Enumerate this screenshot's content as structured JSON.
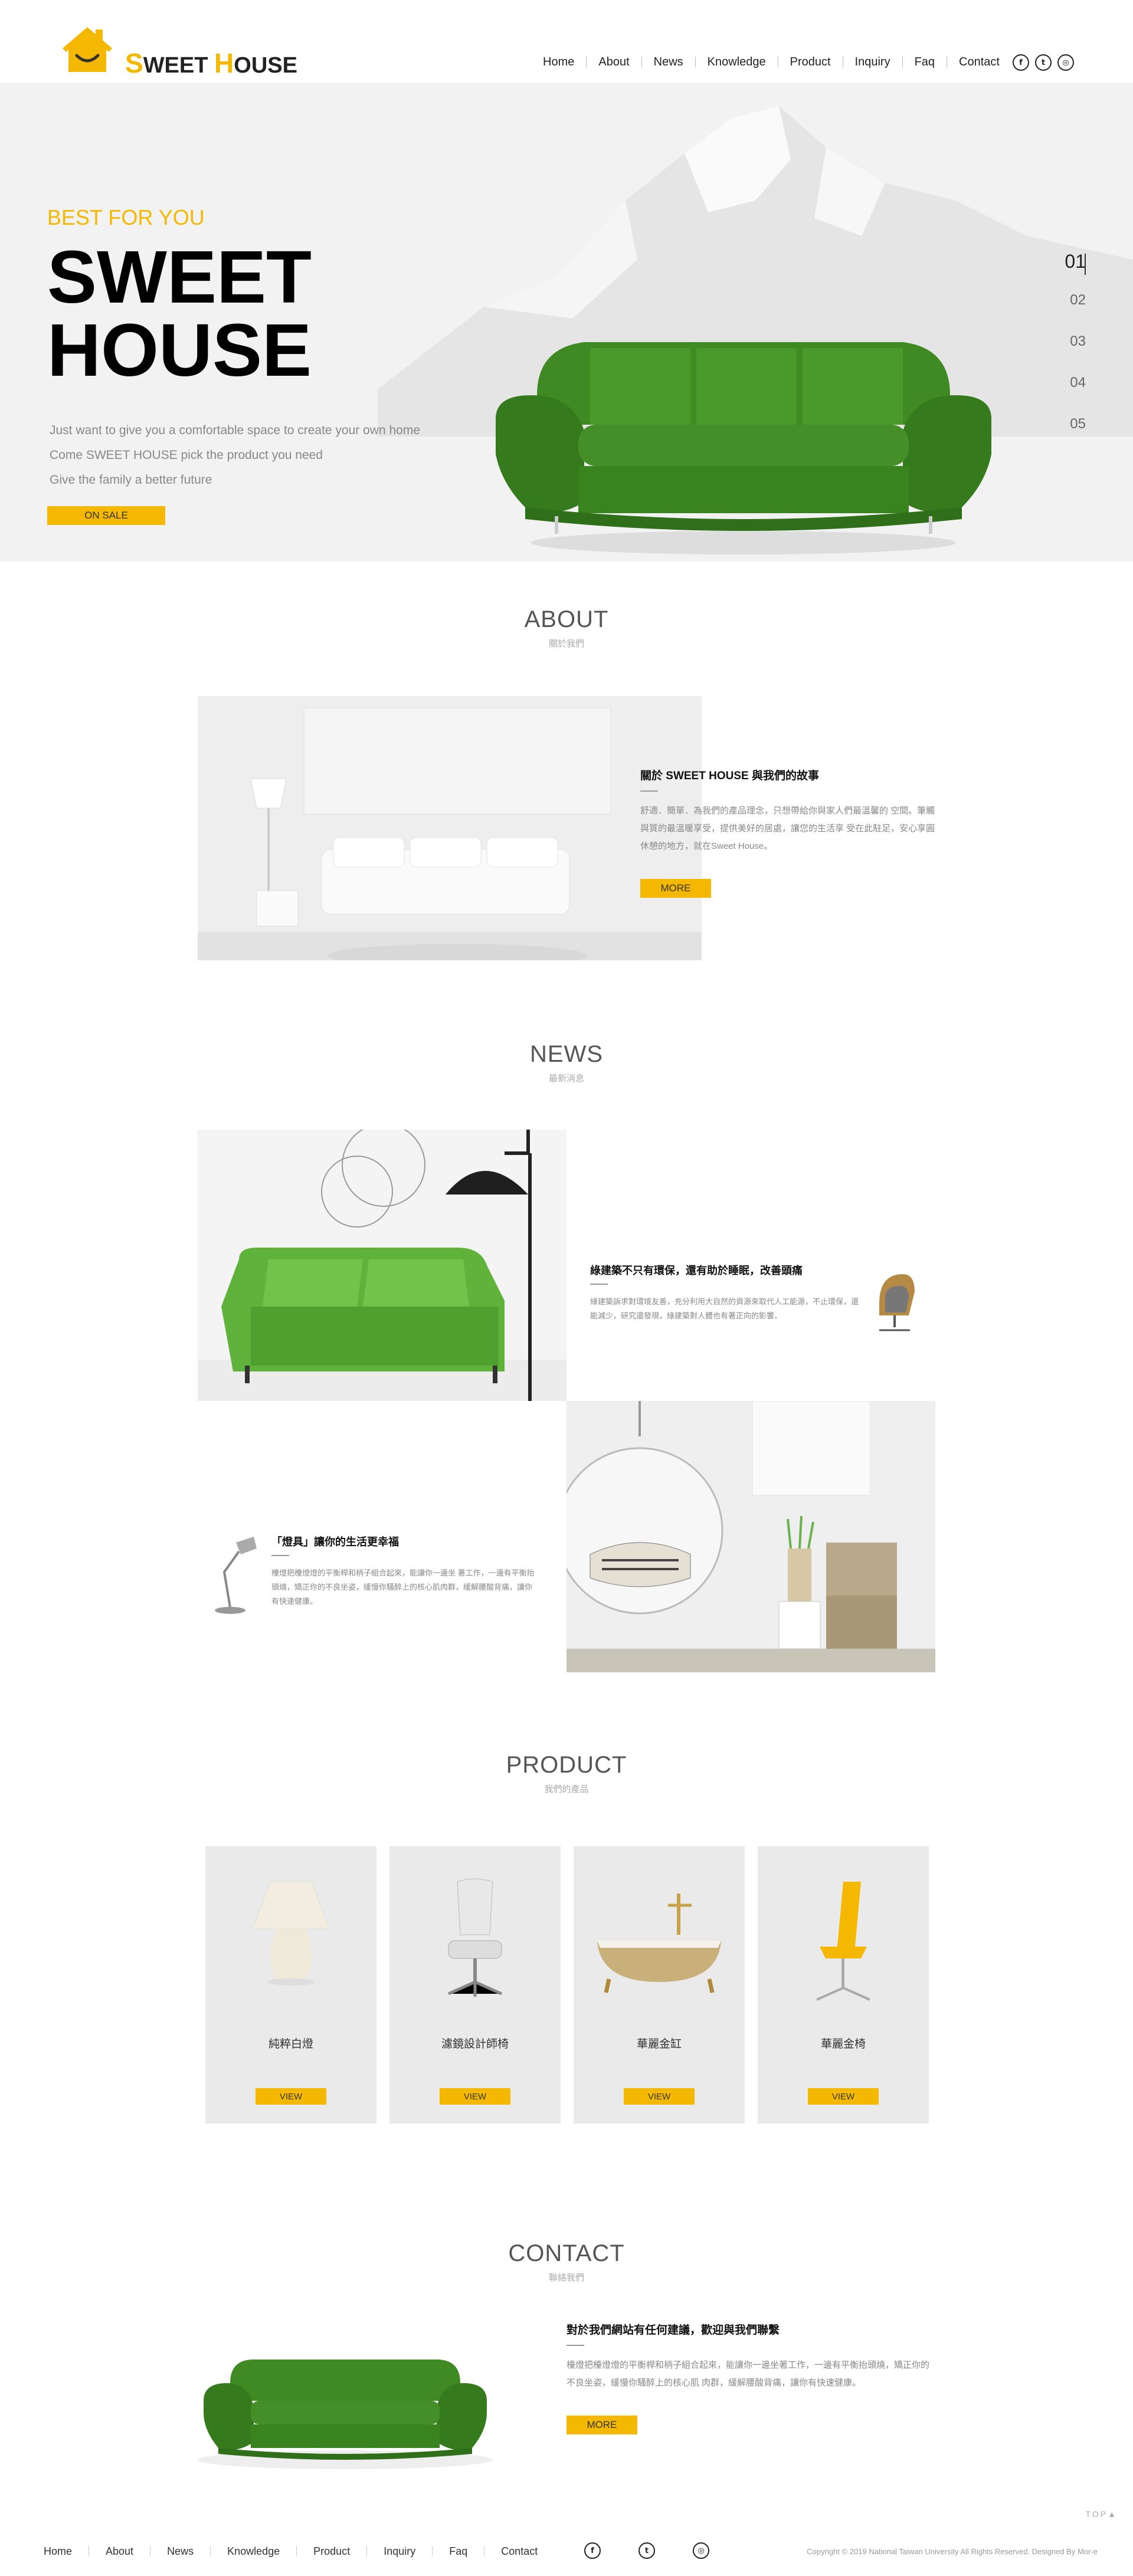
{
  "header": {
    "logo": {
      "initial_1": "S",
      "word_1": "WEET",
      "initial_2": "H",
      "word_2": "OUSE"
    },
    "nav": [
      "Home",
      "About",
      "News",
      "Knowledge",
      "Product",
      "Inquiry",
      "Faq",
      "Contact"
    ],
    "social_icons": [
      "facebook-icon",
      "twitter-icon",
      "instagram-icon"
    ]
  },
  "hero": {
    "tag": "BEST FOR YOU",
    "title_line1": "SWEET",
    "title_line2": "HOUSE",
    "lines": [
      "Just want to give you a comfortable space to create your own home",
      "Come SWEET HOUSE pick the product you need",
      "Give the family a better future"
    ],
    "cta": "ON SALE",
    "pager": [
      "01",
      "02",
      "03",
      "04",
      "05"
    ],
    "active_page": "01"
  },
  "about": {
    "title": "ABOUT",
    "subtitle": "關於我們",
    "heading": "關於 SWEET HOUSE 與我們的故事",
    "body": "舒適．簡單．為我們的產品理念，只想帶給你與家人們最溫馨的 空間。筆觸與質的最溫暖享受，提供美好的居處，讓您的生活享 受在此駐足，安心享圓休憩的地方，就在Sweet House。",
    "button": "MORE"
  },
  "news": {
    "title": "NEWS",
    "subtitle": "最新消息",
    "items": [
      {
        "heading": "綠建築不只有環保，還有助於睡眠，改善頭痛",
        "body": "綠建築訴求對環境友善，充分利用大自然的資源來取代人工能源，不止環保，還能減少，研究還發現，綠建築對人體也有著正向的影響。"
      },
      {
        "heading": "「燈具」讓你的生活更幸福",
        "body": "檯燈把檯燈燈的平衡桿和柄子組合起來，能讓你一邊坐 著工作，一邊有平衡抬頭燒，矯正你的不良坐姿，緩慢你騷醉上的核心肌肉群，緩解腰酸背痛，讓你有快速健康。"
      }
    ]
  },
  "product": {
    "title": "PRODUCT",
    "subtitle": "我們的產品",
    "items": [
      {
        "name": "純粹白燈",
        "button": "VIEW"
      },
      {
        "name": "濾鏡設計師椅",
        "button": "VIEW"
      },
      {
        "name": "華麗金缸",
        "button": "VIEW"
      },
      {
        "name": "華麗金椅",
        "button": "VIEW"
      }
    ]
  },
  "contact": {
    "title": "CONTACT",
    "subtitle": "聯絡我們",
    "heading": "對於我們網站有任何建議，歡迎與我們聯繫",
    "body": "檯燈把檯燈燈的平衡桿和柄子組合起來，能讓你一邊坐著工作，一邊有平衡抬頭燒，矯正你的不良坐姿，緩慢你騷醉上的核心肌 肉群，緩解腰酸背痛，讓你有快速健康。",
    "button": "MORE"
  },
  "footer": {
    "nav": [
      "Home",
      "About",
      "News",
      "Knowledge",
      "Product",
      "Inquiry",
      "Faq",
      "Contact"
    ],
    "copyright": "Copyright © 2019 National Taiwan University All Rights Reserved. Designed By Mor-e",
    "top": "TOP▲"
  },
  "colors": {
    "accent": "#f5b800",
    "sofa_green": "#3e8a22",
    "hero_bg": "#f2f2f2",
    "card_bg": "#eaeaea"
  }
}
